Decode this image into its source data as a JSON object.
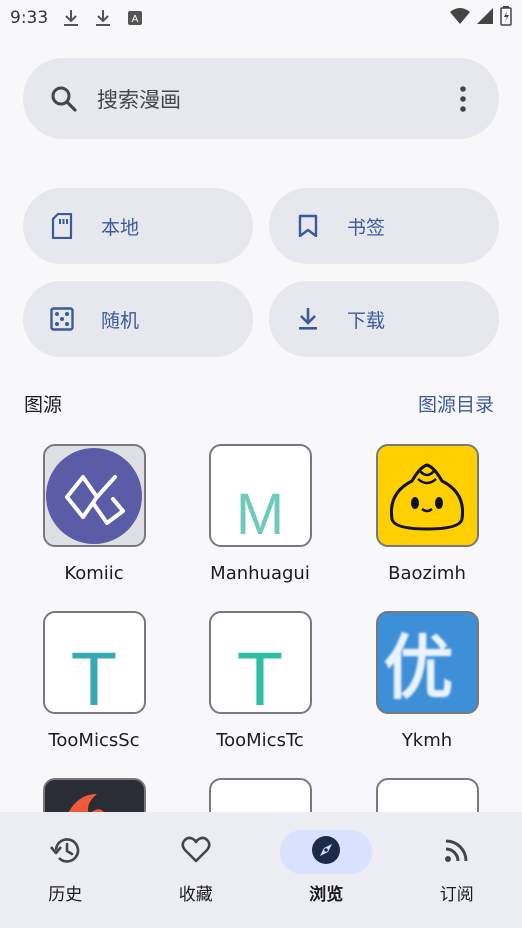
{
  "status_bar": {
    "time": "9:33",
    "left_icons": [
      "download-icon",
      "download-icon",
      "font-icon"
    ],
    "right_icons": [
      "wifi-icon",
      "signal-icon",
      "battery-icon"
    ]
  },
  "search": {
    "placeholder": "搜索漫画",
    "icon": "search-icon",
    "menu_icon": "more-vert-icon"
  },
  "quick_actions": [
    {
      "label": "本地",
      "icon": "sd-card-icon"
    },
    {
      "label": "书签",
      "icon": "bookmark-icon"
    },
    {
      "label": "随机",
      "icon": "dice-icon"
    },
    {
      "label": "下载",
      "icon": "download-icon"
    }
  ],
  "sources_section": {
    "title": "图源",
    "link": "图源目录"
  },
  "sources": [
    {
      "name": "Komiic",
      "logo": "komiic-logo"
    },
    {
      "name": "Manhuagui",
      "logo": "manhuagui-logo",
      "letter": "M"
    },
    {
      "name": "Baozimh",
      "logo": "baozimh-logo"
    },
    {
      "name": "TooMicsSc",
      "logo": "toomics-sc-logo",
      "letter": "T"
    },
    {
      "name": "TooMicsTc",
      "logo": "toomics-tc-logo",
      "letter": "T"
    },
    {
      "name": "Ykmh",
      "logo": "ykmh-logo",
      "letter": "优"
    },
    {
      "name": "",
      "logo": "partial-logo-1"
    },
    {
      "name": "",
      "logo": "partial-logo-2"
    },
    {
      "name": "",
      "logo": "partial-logo-3"
    }
  ],
  "bottom_nav": [
    {
      "label": "历史",
      "icon": "history-icon",
      "active": false
    },
    {
      "label": "收藏",
      "icon": "heart-icon",
      "active": false
    },
    {
      "label": "浏览",
      "icon": "compass-icon",
      "active": true
    },
    {
      "label": "订阅",
      "icon": "rss-icon",
      "active": false
    }
  ],
  "colors": {
    "accent": "#3a5a9c",
    "surface": "#e7e8ee",
    "active_pill": "#d8e2ff",
    "teal": "#43b5a0"
  }
}
